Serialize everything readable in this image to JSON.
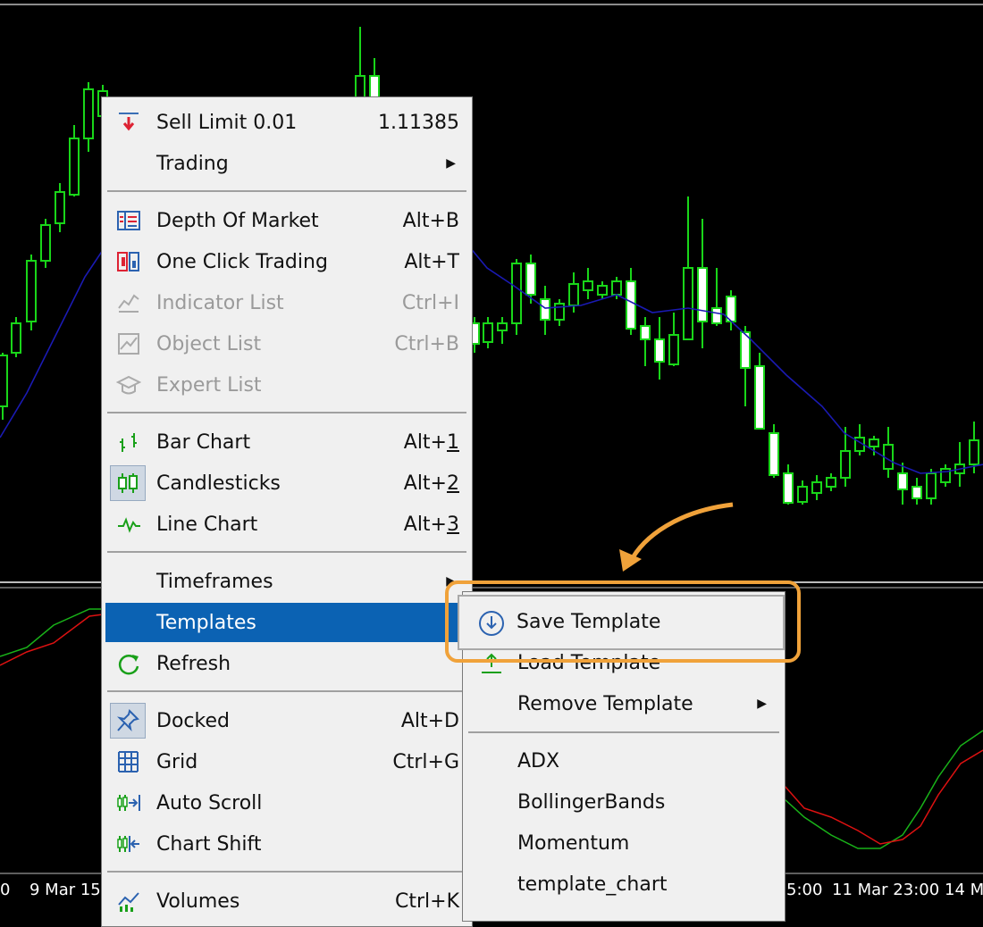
{
  "colors": {
    "bull": "#19d619",
    "bear": "#ffffff",
    "ma": "#1a1ab3",
    "highlight": "#f0a23a",
    "menu_hl": "#0b62b3"
  },
  "chart": {
    "x_labels": [
      "0",
      "9 Mar 15:",
      "5:00",
      "11 Mar 23:00",
      "14 M"
    ]
  },
  "context_menu": {
    "items": [
      {
        "id": "sell",
        "icon": "sell-limit-icon",
        "label": "Sell Limit 0.01",
        "shortcut": "1.11385"
      },
      {
        "id": "trading",
        "label": "Trading",
        "submenu": true
      },
      {
        "id": "dom",
        "icon": "depth-of-market-icon",
        "label": "Depth Of Market",
        "shortcut": "Alt+B"
      },
      {
        "id": "oneclick",
        "icon": "one-click-trading-icon",
        "label": "One Click Trading",
        "shortcut": "Alt+T"
      },
      {
        "id": "indlist",
        "icon": "indicator-list-icon",
        "label": "Indicator List",
        "shortcut": "Ctrl+I",
        "disabled": true
      },
      {
        "id": "objlist",
        "icon": "object-list-icon",
        "label": "Object List",
        "shortcut": "Ctrl+B",
        "disabled": true
      },
      {
        "id": "explist",
        "icon": "expert-list-icon",
        "label": "Expert List",
        "disabled": true
      },
      {
        "id": "bar",
        "icon": "bar-chart-icon",
        "label": "Bar Chart",
        "shortcut_prefix": "Alt+",
        "shortcut_key": "1"
      },
      {
        "id": "candle",
        "icon": "candlesticks-icon",
        "label": "Candlesticks",
        "shortcut_prefix": "Alt+",
        "shortcut_key": "2",
        "checked": true
      },
      {
        "id": "line",
        "icon": "line-chart-icon",
        "label": "Line Chart",
        "shortcut_prefix": "Alt+",
        "shortcut_key": "3"
      },
      {
        "id": "tf",
        "label": "Timeframes",
        "submenu": true
      },
      {
        "id": "tpl",
        "label": "Templates",
        "submenu": true,
        "highlighted": true
      },
      {
        "id": "refresh",
        "icon": "refresh-icon",
        "label": "Refresh"
      },
      {
        "id": "docked",
        "icon": "pin-icon",
        "label": "Docked",
        "shortcut": "Alt+D",
        "checked": true
      },
      {
        "id": "grid",
        "icon": "grid-icon",
        "label": "Grid",
        "shortcut": "Ctrl+G"
      },
      {
        "id": "autoscroll",
        "icon": "auto-scroll-icon",
        "label": "Auto Scroll"
      },
      {
        "id": "shift",
        "icon": "chart-shift-icon",
        "label": "Chart Shift"
      },
      {
        "id": "volumes",
        "icon": "volumes-icon",
        "label": "Volumes",
        "shortcut": "Ctrl+K"
      }
    ]
  },
  "templates_submenu": {
    "save_label": "Save Template",
    "load_label": "Load Template",
    "remove_label": "Remove Template",
    "templates": [
      "ADX",
      "BollingerBands",
      "Momentum",
      "template_chart"
    ]
  }
}
